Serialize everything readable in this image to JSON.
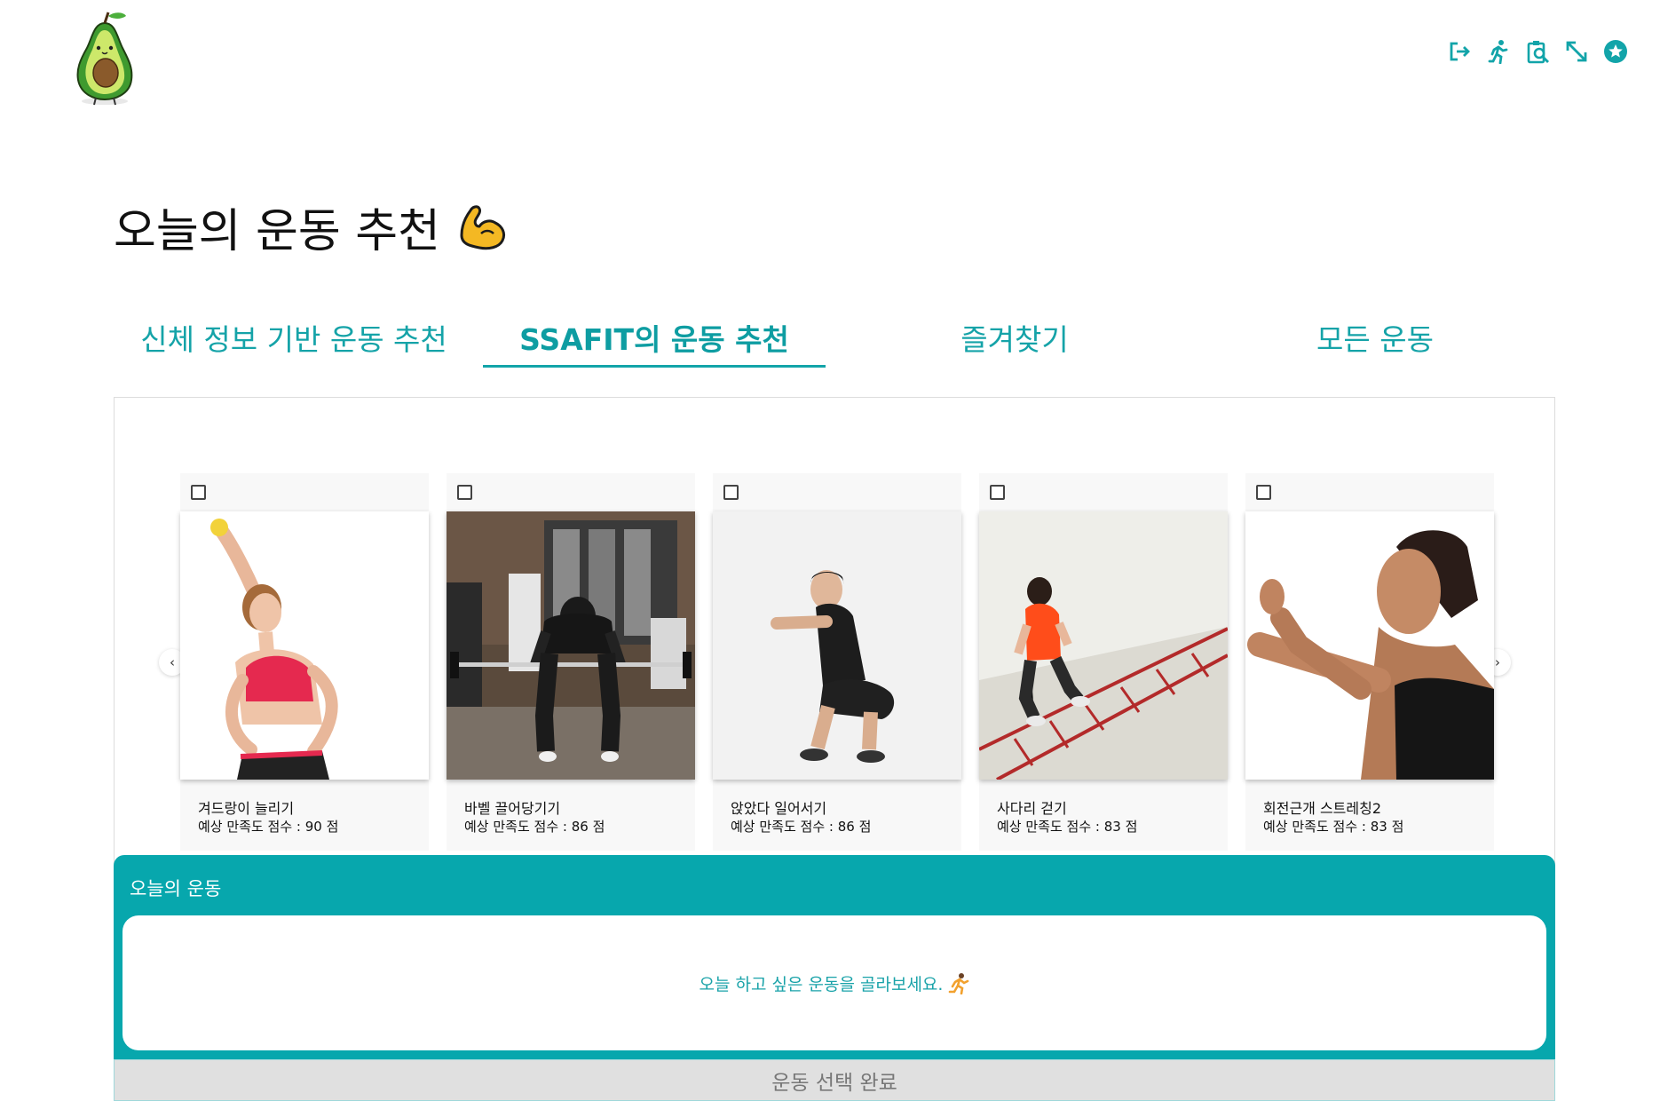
{
  "header": {
    "logo_icon": "avocado-mascot-logo",
    "nav_icons": [
      "logout-icon",
      "running-icon",
      "clipboard-search-icon",
      "resize-arrows-icon",
      "star-circle-icon"
    ],
    "accent_color": "#12a4a9"
  },
  "page_title": "오늘의 운동 추천",
  "page_title_icon": "flexed-biceps-emoji",
  "tabs": [
    {
      "label": "신체 정보 기반 운동 추천",
      "active": false
    },
    {
      "label": "SSAFIT의 운동 추천",
      "active": true
    },
    {
      "label": "즐겨찾기",
      "active": false
    },
    {
      "label": "모든 운동",
      "active": false
    }
  ],
  "carousel": {
    "prev_label": "‹",
    "next_label": "›",
    "cards": [
      {
        "name": "겨드랑이 늘리기",
        "score": "예상 만족도 점수 : 90 점",
        "checked": false
      },
      {
        "name": "바벨 끌어당기기",
        "score": "예상 만족도 점수 : 86 점",
        "checked": false
      },
      {
        "name": "앉았다 일어서기",
        "score": "예상 만족도 점수 : 86 점",
        "checked": false
      },
      {
        "name": "사다리 걷기",
        "score": "예상 만족도 점수 : 83 점",
        "checked": false
      },
      {
        "name": "회전근개 스트레칭2",
        "score": "예상 만족도 점수 : 83 점",
        "checked": false
      }
    ]
  },
  "today": {
    "title": "오늘의 운동",
    "message": "오늘 하고 싶은 운동을 골라보세요.",
    "message_icon": "runner-emoji",
    "box_color": "#07a7ad"
  },
  "done_button": "운동 선택 완료"
}
